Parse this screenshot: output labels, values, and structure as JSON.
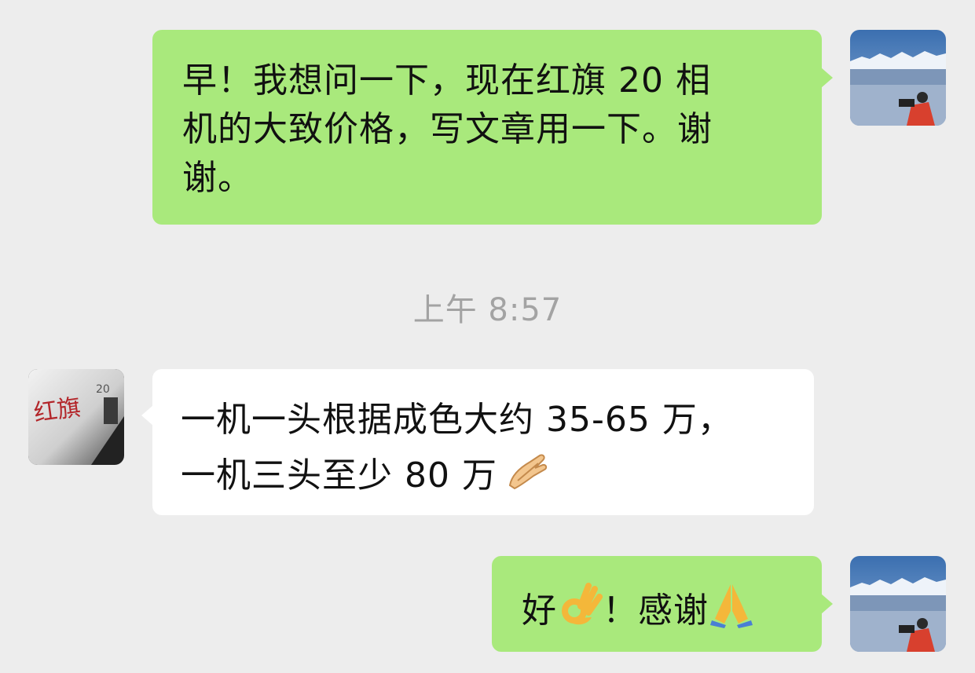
{
  "chat": {
    "messages": [
      {
        "direction": "outgoing",
        "lines": [
          "早！我想问一下，现在红旗 20 相",
          "机的大致价格，写文章用一下。谢",
          "谢。"
        ]
      },
      {
        "direction": "incoming",
        "lines": [
          "一机一头根据成色大约 35-65 万，",
          "一机三头至少 80 万"
        ],
        "trailing_icon": "pinched-fingers-icon"
      },
      {
        "direction": "outgoing",
        "parts": [
          "好",
          "！感谢"
        ],
        "icons": [
          "ok-hand-icon",
          "folded-hands-icon"
        ]
      }
    ],
    "timestamp": "上午 8:57",
    "avatar_contact_text": {
      "brand": "红旗",
      "number": "20"
    }
  },
  "colors": {
    "background": "#ededed",
    "outgoing_bubble": "#a9e97c",
    "incoming_bubble": "#ffffff",
    "timestamp_text": "#a3a3a3"
  }
}
